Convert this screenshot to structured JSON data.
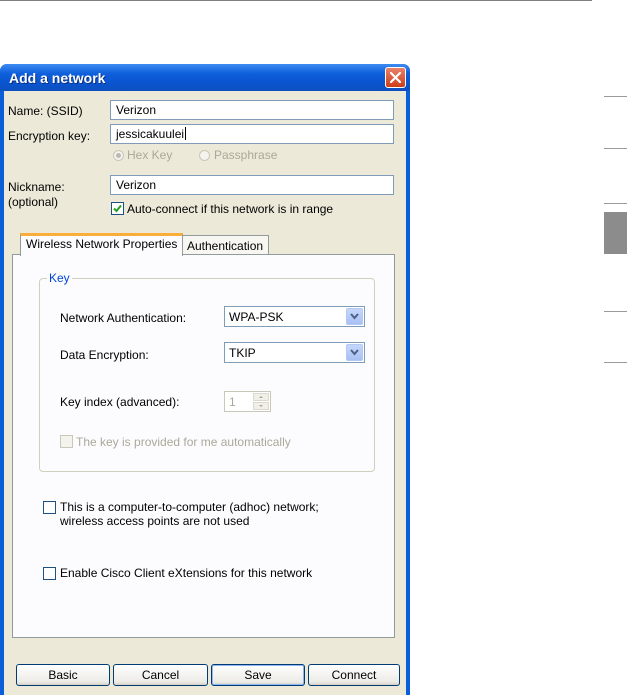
{
  "window": {
    "title": "Add a network"
  },
  "fields": {
    "name_label": "Name:  (SSID)",
    "name_value": "Verizon",
    "encryption_label": "Encryption key:",
    "encryption_value": "jessicakuulei",
    "hex_key_label": "Hex Key",
    "passphrase_label": "Passphrase",
    "nickname_label_line1": "Nickname:",
    "nickname_label_line2": "(optional)",
    "nickname_value": "Verizon",
    "autoconnect_label": "Auto-connect if this network is in range",
    "autoconnect_checked": true
  },
  "tabs": [
    {
      "label": "Wireless Network Properties",
      "active": true
    },
    {
      "label": "Authentication",
      "active": false
    }
  ],
  "key_group": {
    "title": "Key",
    "network_auth_label": "Network Authentication:",
    "network_auth_value": "WPA-PSK",
    "data_encryption_label": "Data Encryption:",
    "data_encryption_value": "TKIP",
    "key_index_label": "Key index (advanced):",
    "key_index_value": "1",
    "auto_key_label": "The key is provided for me automatically",
    "auto_key_checked": false
  },
  "adhoc": {
    "line1": "This is a computer-to-computer (adhoc) network;",
    "line2": "wireless access points are not used",
    "checked": false
  },
  "cisco": {
    "label": "Enable Cisco Client eXtensions for this network",
    "checked": false
  },
  "buttons": {
    "basic": "Basic",
    "cancel": "Cancel",
    "save": "Save",
    "connect": "Connect"
  },
  "colors": {
    "titlebar": "#0a5ed8",
    "client": "#ece9d8",
    "tab_highlight": "#f9ae3b",
    "group_title": "#0046d5"
  }
}
